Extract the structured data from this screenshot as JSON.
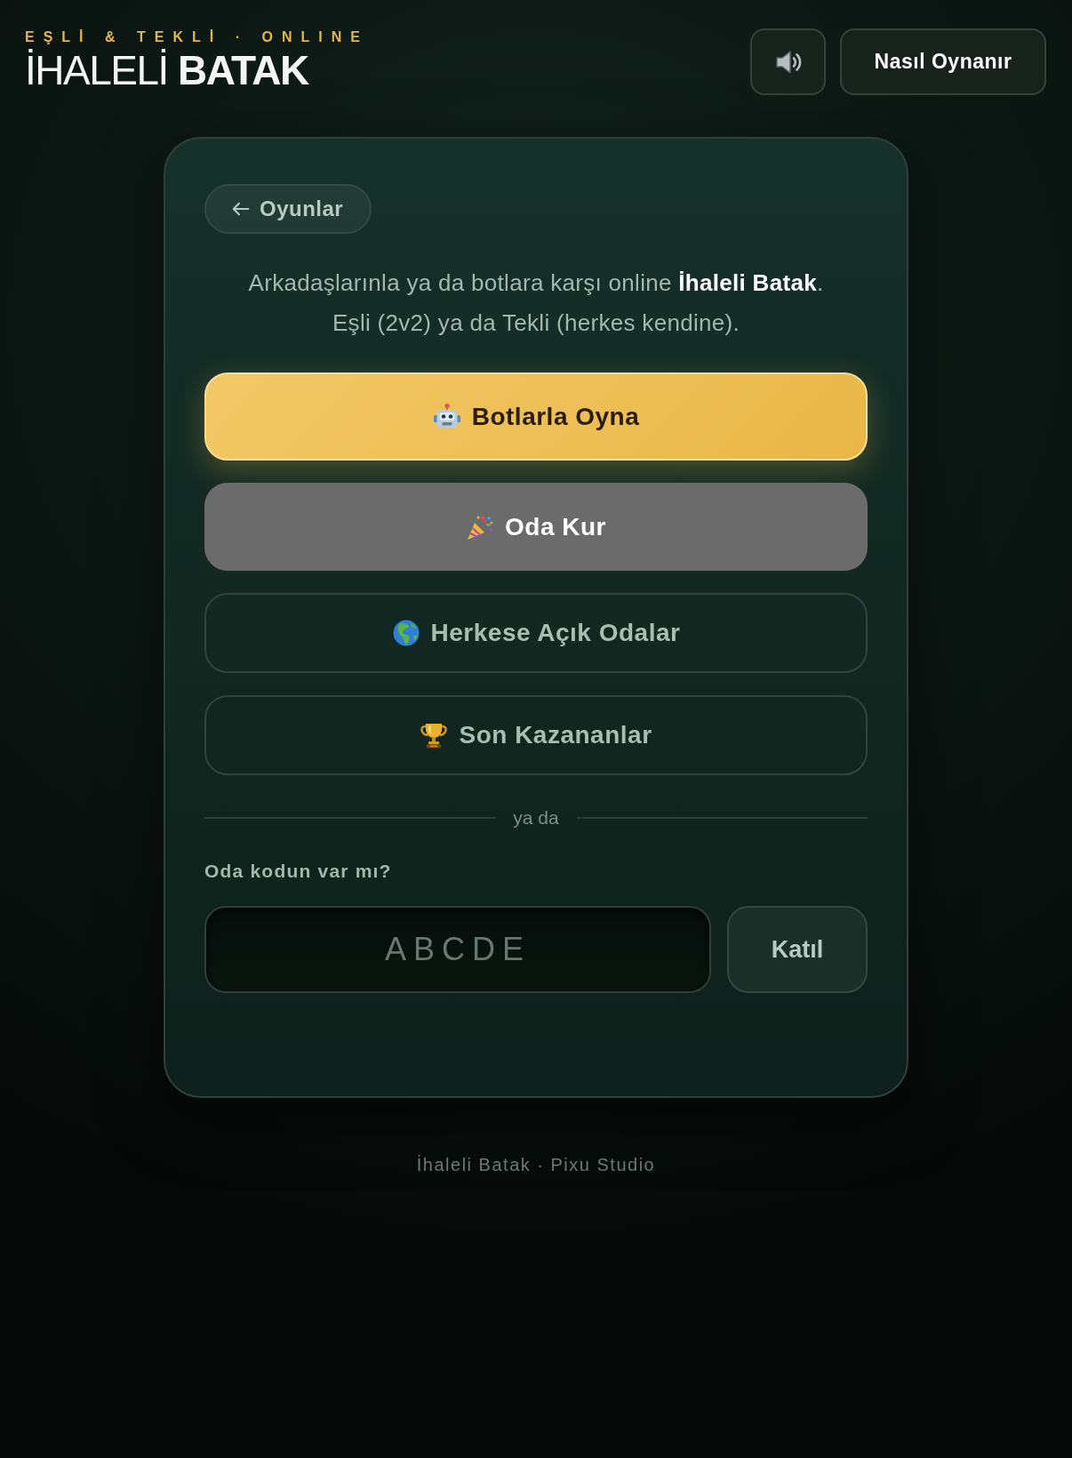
{
  "header": {
    "tagline": "EŞLİ & TEKLİ · ONLINE",
    "title": "İHALELİ **BATAK**",
    "sound_button": {
      "on": true
    },
    "help_button": {
      "label": "Nasıl Oynanır"
    }
  },
  "card": {
    "back_button": {
      "label": "Oyunlar"
    },
    "intro": "Arkadaşlarınla ya da botlara karşı online **İhaleli Batak**.\nEşli (2v2) ya da Tekli (herkes kendine).",
    "mode_buttons": [
      {
        "kind": "primary",
        "label": "Botlarla Oyna"
      },
      {
        "kind": "secondary",
        "label": "Oda Kur"
      },
      {
        "kind": "outline",
        "label": "Herkese Açık Odalar"
      },
      {
        "kind": "outline",
        "label": "Son Kazananlar"
      }
    ],
    "divider": "ya da",
    "join": {
      "label": "Oda kodun var mı?",
      "placeholder": "ABCDE",
      "button": "Katıl"
    }
  },
  "footer": "İhaleli Batak · Pixu Studio"
}
